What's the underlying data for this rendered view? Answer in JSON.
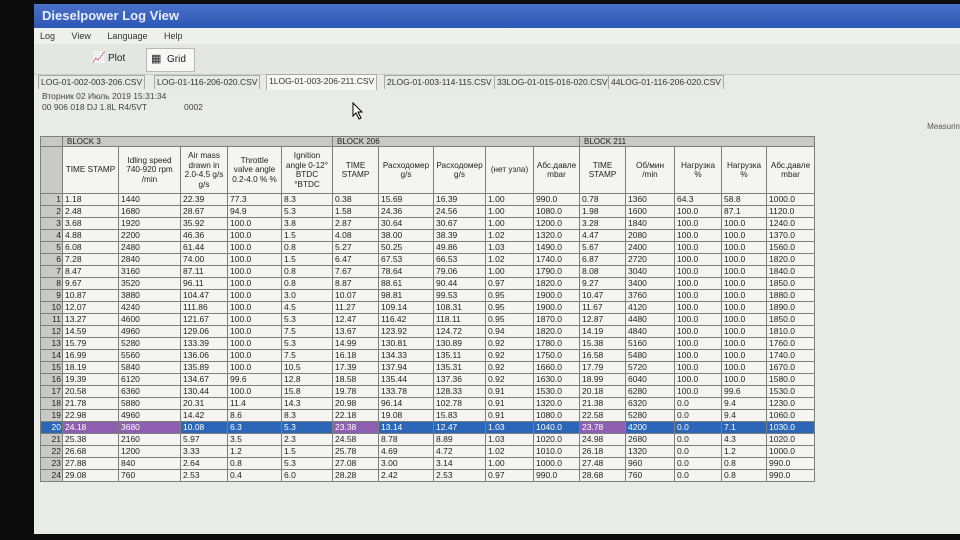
{
  "window": {
    "title": "Dieselpower Log View"
  },
  "menu": [
    "Log",
    "View",
    "Language",
    "Help"
  ],
  "toolbar": {
    "plot_label": "Plot",
    "grid_label": "Grid"
  },
  "tabs": [
    "LOG-01-002-003-206.CSV",
    "LOG-01-116-206-020.CSV",
    "1LOG-01-003-206-211.CSV",
    "2LOG-01-003-114-115.CSV",
    "33LOG-01-015-016-020.CSV",
    "44LOG-01-116-206-020.CSV"
  ],
  "active_tab": 2,
  "info": {
    "date": "Вторник 02 Июль 2019 15:31:34",
    "ecu": "00 906 018 DJ  1.8L R4/5VT",
    "code": "0002",
    "right_note": "Measurin"
  },
  "grid": {
    "blocks": [
      "BLOCK 3",
      "BLOCK 206",
      "BLOCK 211"
    ],
    "headers": [
      "TIME STAMP",
      "Idling speed 740-920 rpm /min",
      "Air mass drawn in 2.0-4.5 g/s g/s",
      "Throttle valve angle 0.2-4.0 % %",
      "Ignition angle 0-12° BTDC °BTDC",
      "TIME STAMP",
      "Расходомер g/s",
      "Расходомер g/s",
      "(нет узла)",
      "Абс.давле mbar",
      "TIME STAMP",
      "Об/мин /min",
      "Нагрузка %",
      "Нагрузка %",
      "Абс.давле mbar"
    ],
    "rows": [
      [
        "1",
        "1.18",
        "1440",
        "22.39",
        "77.3",
        "8.3",
        "0.38",
        "15.69",
        "16.39",
        "1.00",
        "990.0",
        "0.78",
        "1360",
        "64.3",
        "58.8",
        "1000.0"
      ],
      [
        "2",
        "2.48",
        "1680",
        "28.67",
        "94.9",
        "5.3",
        "1.58",
        "24.36",
        "24.56",
        "1.00",
        "1080.0",
        "1.98",
        "1600",
        "100.0",
        "87.1",
        "1120.0"
      ],
      [
        "3",
        "3.68",
        "1920",
        "35.92",
        "100.0",
        "3.8",
        "2.87",
        "30.64",
        "30.67",
        "1.00",
        "1200.0",
        "3.28",
        "1840",
        "100.0",
        "100.0",
        "1240.0"
      ],
      [
        "4",
        "4.88",
        "2200",
        "46.36",
        "100.0",
        "1.5",
        "4.08",
        "38.00",
        "38.39",
        "1.02",
        "1320.0",
        "4.47",
        "2080",
        "100.0",
        "100.0",
        "1370.0"
      ],
      [
        "5",
        "6.08",
        "2480",
        "61.44",
        "100.0",
        "0.8",
        "5.27",
        "50.25",
        "49.86",
        "1.03",
        "1490.0",
        "5.67",
        "2400",
        "100.0",
        "100.0",
        "1560.0"
      ],
      [
        "6",
        "7.28",
        "2840",
        "74.00",
        "100.0",
        "1.5",
        "6.47",
        "67.53",
        "66.53",
        "1.02",
        "1740.0",
        "6.87",
        "2720",
        "100.0",
        "100.0",
        "1820.0"
      ],
      [
        "7",
        "8.47",
        "3160",
        "87.11",
        "100.0",
        "0.8",
        "7.67",
        "78.64",
        "79.06",
        "1.00",
        "1790.0",
        "8.08",
        "3040",
        "100.0",
        "100.0",
        "1840.0"
      ],
      [
        "8",
        "9.67",
        "3520",
        "96.11",
        "100.0",
        "0.8",
        "8.87",
        "88.61",
        "90.44",
        "0.97",
        "1820.0",
        "9.27",
        "3400",
        "100.0",
        "100.0",
        "1850.0"
      ],
      [
        "9",
        "10.87",
        "3880",
        "104.47",
        "100.0",
        "3.0",
        "10.07",
        "98.81",
        "99.53",
        "0.95",
        "1900.0",
        "10.47",
        "3760",
        "100.0",
        "100.0",
        "1880.0"
      ],
      [
        "10",
        "12.07",
        "4240",
        "111.86",
        "100.0",
        "4.5",
        "11.27",
        "109.14",
        "108.31",
        "0.95",
        "1900.0",
        "11.67",
        "4120",
        "100.0",
        "100.0",
        "1890.0"
      ],
      [
        "11",
        "13.27",
        "4600",
        "121.67",
        "100.0",
        "5.3",
        "12.47",
        "116.42",
        "118.11",
        "0.95",
        "1870.0",
        "12.87",
        "4480",
        "100.0",
        "100.0",
        "1850.0"
      ],
      [
        "12",
        "14.59",
        "4960",
        "129.06",
        "100.0",
        "7.5",
        "13.67",
        "123.92",
        "124.72",
        "0.94",
        "1820.0",
        "14.19",
        "4840",
        "100.0",
        "100.0",
        "1810.0"
      ],
      [
        "13",
        "15.79",
        "5280",
        "133.39",
        "100.0",
        "5.3",
        "14.99",
        "130.81",
        "130.89",
        "0.92",
        "1780.0",
        "15.38",
        "5160",
        "100.0",
        "100.0",
        "1760.0"
      ],
      [
        "14",
        "16.99",
        "5560",
        "136.06",
        "100.0",
        "7.5",
        "16.18",
        "134.33",
        "135.11",
        "0.92",
        "1750.0",
        "16.58",
        "5480",
        "100.0",
        "100.0",
        "1740.0"
      ],
      [
        "15",
        "18.19",
        "5840",
        "135.89",
        "100.0",
        "10.5",
        "17.39",
        "137.94",
        "135.31",
        "0.92",
        "1660.0",
        "17.79",
        "5720",
        "100.0",
        "100.0",
        "1670.0"
      ],
      [
        "16",
        "19.39",
        "6120",
        "134.67",
        "99.6",
        "12.8",
        "18.58",
        "135.44",
        "137.36",
        "0.92",
        "1630.0",
        "18.99",
        "6040",
        "100.0",
        "100.0",
        "1580.0"
      ],
      [
        "17",
        "20.58",
        "6360",
        "130.44",
        "100.0",
        "15.8",
        "19.78",
        "133.78",
        "128.33",
        "0.91",
        "1530.0",
        "20.18",
        "6280",
        "100.0",
        "99.6",
        "1530.0"
      ],
      [
        "18",
        "21.78",
        "5880",
        "20.31",
        "11.4",
        "14.3",
        "20.98",
        "96.14",
        "102.78",
        "0.91",
        "1320.0",
        "21.38",
        "6320",
        "0.0",
        "9.4",
        "1230.0"
      ],
      [
        "19",
        "22.98",
        "4960",
        "14.42",
        "8.6",
        "8.3",
        "22.18",
        "19.08",
        "15.83",
        "0.91",
        "1080.0",
        "22.58",
        "5280",
        "0.0",
        "9.4",
        "1060.0"
      ],
      [
        "20",
        "24.18",
        "3680",
        "10.08",
        "6.3",
        "5.3",
        "23.38",
        "13.14",
        "12.47",
        "1.03",
        "1040.0",
        "23.78",
        "4200",
        "0.0",
        "7.1",
        "1030.0"
      ],
      [
        "21",
        "25.38",
        "2160",
        "5.97",
        "3.5",
        "2.3",
        "24.58",
        "8.78",
        "8.89",
        "1.03",
        "1020.0",
        "24.98",
        "2680",
        "0.0",
        "4.3",
        "1020.0"
      ],
      [
        "22",
        "26.68",
        "1200",
        "3.33",
        "1.2",
        "1.5",
        "25.78",
        "4.69",
        "4.72",
        "1.02",
        "1010.0",
        "26.18",
        "1320",
        "0.0",
        "1.2",
        "1000.0"
      ],
      [
        "23",
        "27.88",
        "840",
        "2.64",
        "0.8",
        "5.3",
        "27.08",
        "3.00",
        "3.14",
        "1.00",
        "1000.0",
        "27.48",
        "960",
        "0.0",
        "0.8",
        "990.0"
      ],
      [
        "24",
        "29.08",
        "760",
        "2.53",
        "0.4",
        "6.0",
        "28.28",
        "2.42",
        "2.53",
        "0.97",
        "990.0",
        "28.68",
        "760",
        "0.0",
        "0.8",
        "990.0"
      ]
    ],
    "selected_row": 19
  },
  "colors": {
    "selection": "#2b66b8",
    "selection_time": "#8e5fb0",
    "titlebar": "#3a63bf"
  }
}
